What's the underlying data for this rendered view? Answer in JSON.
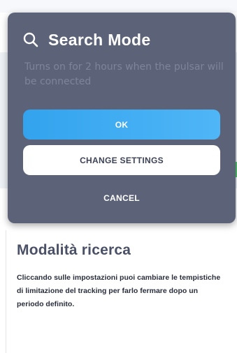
{
  "dialog": {
    "title": "Search Mode",
    "message": "Turns on for 2 hours when the pulsar will be connected",
    "buttons": {
      "ok": "OK",
      "change_settings": "CHANGE SETTINGS",
      "cancel": "CANCEL"
    },
    "icon": "search-icon"
  },
  "page": {
    "heading": "Modalità ricerca",
    "paragraph": "Cliccando sulle impostazioni puoi cambiare le tempistiche di limitazione del tracking per farlo fermare dopo un periodo definito."
  },
  "colors": {
    "dialog_bg": "#5c6278",
    "accent": "#33a3ee",
    "heading": "#4a5066"
  }
}
